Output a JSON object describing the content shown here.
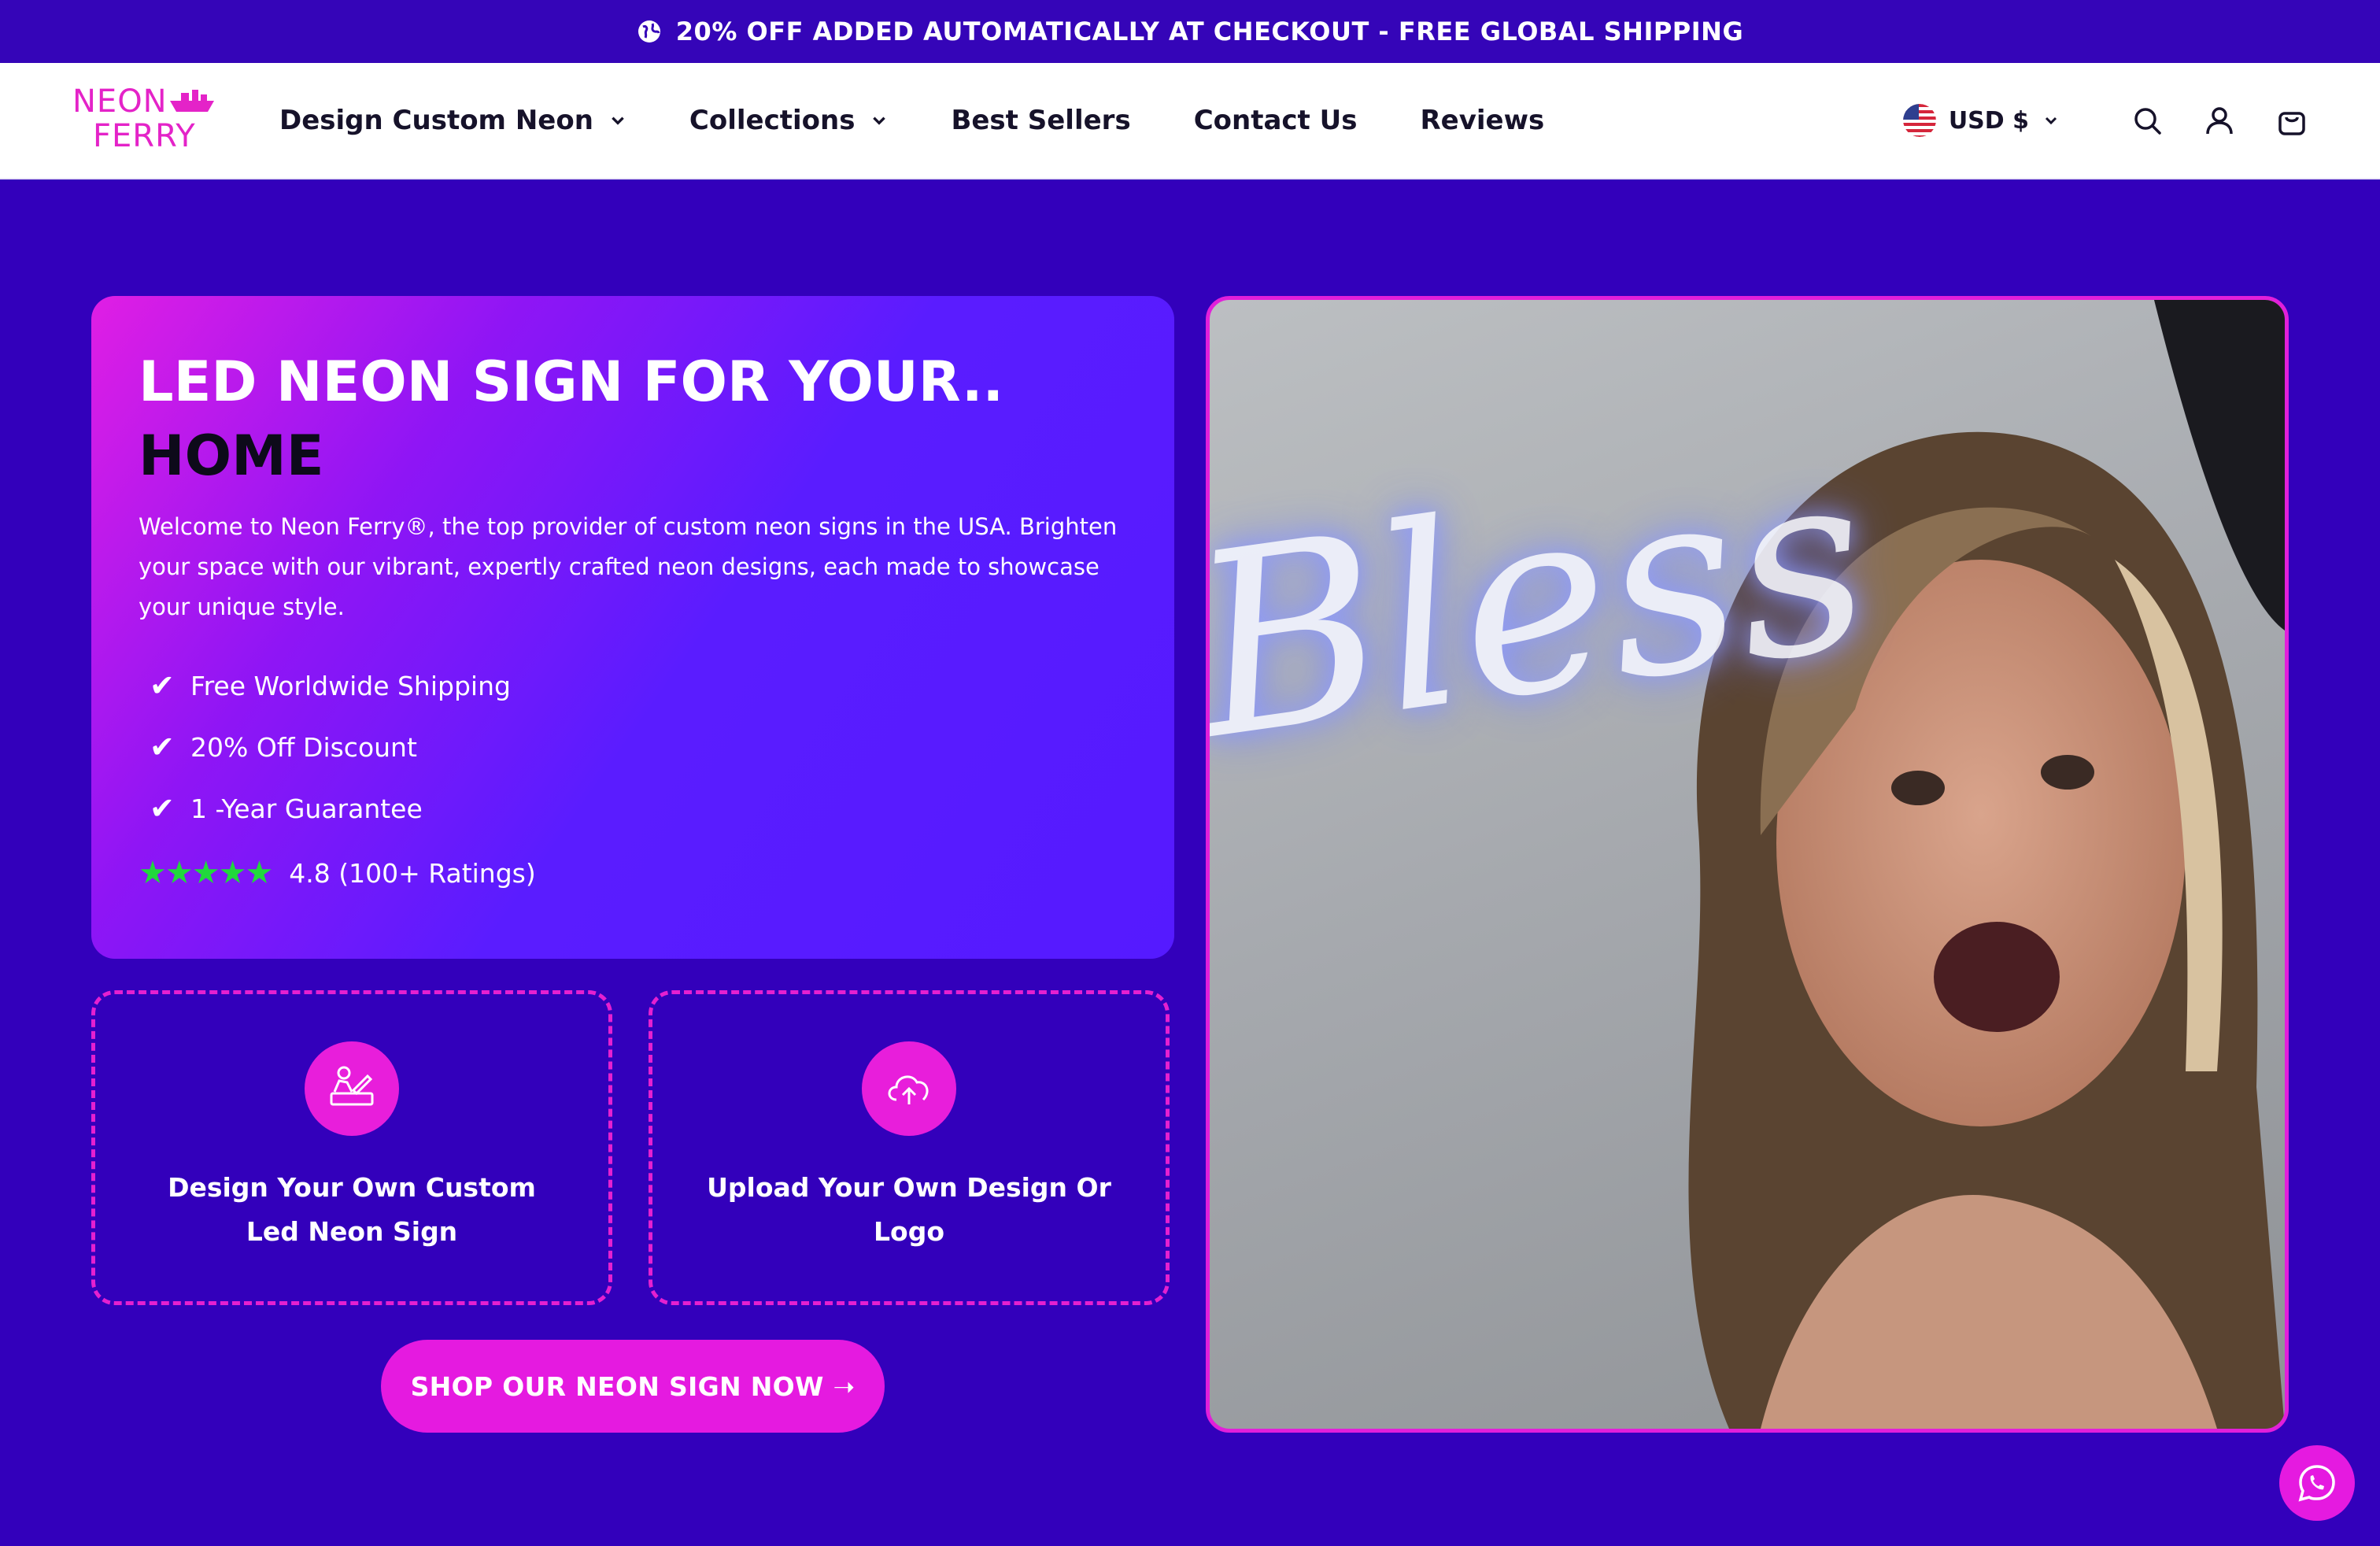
{
  "announcement": {
    "icon": "globe-icon",
    "text": "20% OFF ADDED AUTOMATICALLY AT CHECKOUT - FREE GLOBAL SHIPPING"
  },
  "header": {
    "logo": {
      "line1": "NEON",
      "line2": "FERRY",
      "icon": "ship-icon",
      "color": "#e423c8"
    },
    "nav": [
      {
        "label": "Design Custom Neon",
        "has_dropdown": true
      },
      {
        "label": "Collections",
        "has_dropdown": true
      },
      {
        "label": "Best Sellers",
        "has_dropdown": false
      },
      {
        "label": "Contact Us",
        "has_dropdown": false
      },
      {
        "label": "Reviews",
        "has_dropdown": false
      }
    ],
    "currency": {
      "label": "USD $",
      "flag": "us-flag-icon"
    },
    "icons": [
      "search-icon",
      "account-icon",
      "cart-icon"
    ]
  },
  "hero": {
    "title_line1": "LED NEON SIGN FOR YOUR..",
    "title_line2": "HOME",
    "description": "Welcome to Neon Ferry®, the top provider of custom neon signs in the USA. Brighten your space with our vibrant, expertly crafted neon designs, each made to showcase your unique style.",
    "features": [
      "Free Worldwide Shipping",
      "20% Off Discount",
      "1 -Year Guarantee"
    ],
    "rating": {
      "stars": "★★★★★",
      "text": "4.8 (100+ Ratings)",
      "value": 4.8,
      "star_color": "#21d83c"
    }
  },
  "options": [
    {
      "label": "Design Your Own Custom Led Neon Sign",
      "icon": "designer-icon"
    },
    {
      "label": "Upload Your Own Design Or Logo",
      "icon": "cloud-upload-icon"
    }
  ],
  "cta": {
    "label": "SHOP OUR NEON SIGN NOW ➝"
  },
  "media": {
    "neon_sign_text": "Bless"
  },
  "chat": {
    "icon": "whatsapp-icon"
  },
  "colors": {
    "background": "#3300bb",
    "accent": "#e51ae0",
    "header_bg": "#ffffff"
  }
}
